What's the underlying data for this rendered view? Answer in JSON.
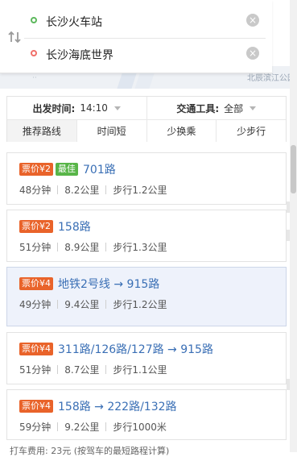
{
  "map": {
    "label_right": "北辰滨江公园",
    "label_left": "··"
  },
  "search": {
    "start": "长沙火车站",
    "end": "长沙海底世界",
    "clear_glyph": "×"
  },
  "filters": {
    "depart_label": "出发时间:",
    "depart_value": "14:10",
    "transport_label": "交通工具:",
    "transport_value": "全部"
  },
  "tabs": [
    {
      "label": "推荐路线",
      "active": true
    },
    {
      "label": "时间短",
      "active": false
    },
    {
      "label": "少换乘",
      "active": false
    },
    {
      "label": "少步行",
      "active": false
    }
  ],
  "routes": [
    {
      "fare": "票价¥2",
      "best": "最佳",
      "line": "701路",
      "duration": "48分钟",
      "distance": "8.2公里",
      "walk": "步行1.2公里",
      "selected": false
    },
    {
      "fare": "票价¥2",
      "best": "",
      "line": "158路",
      "duration": "51分钟",
      "distance": "8.9公里",
      "walk": "步行1.3公里",
      "selected": false
    },
    {
      "fare": "票价¥4",
      "best": "",
      "line": "地铁2号线 → 915路",
      "duration": "49分钟",
      "distance": "9.4公里",
      "walk": "步行1.2公里",
      "selected": true
    },
    {
      "fare": "票价¥4",
      "best": "",
      "line": "311路/126路/127路 → 915路",
      "duration": "51分钟",
      "distance": "8.7公里",
      "walk": "步行1.1公里",
      "selected": false
    },
    {
      "fare": "票价¥4",
      "best": "",
      "line": "158路 → 222路/132路",
      "duration": "59分钟",
      "distance": "9.2公里",
      "walk": "步行1000米",
      "selected": false
    }
  ],
  "footer": {
    "text": "打车费用: 23元 (按驾车的最短路程计算)"
  },
  "colors": {
    "fare_badge": "#e9632a",
    "best_badge": "#58b548",
    "line_link": "#3a6fb5",
    "selected_bg": "#eef2fb"
  }
}
